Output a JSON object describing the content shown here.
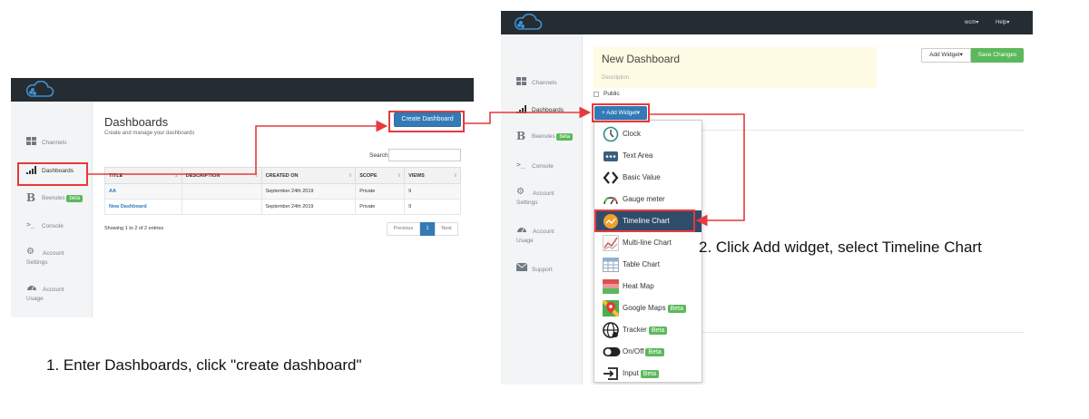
{
  "left": {
    "nav": [
      {
        "label": "Channels",
        "icon": "grid-icon"
      },
      {
        "label": "Dashboards",
        "icon": "bars-chart-icon"
      },
      {
        "label": "Beerules",
        "icon": "beerules-b-icon",
        "badge": "beta"
      },
      {
        "label": "Console",
        "icon": "terminal-icon"
      },
      {
        "label": "Account Settings",
        "icon": "gears-icon"
      },
      {
        "label": "Account Usage",
        "icon": "dashboard-gauge-icon"
      }
    ],
    "title": "Dashboards",
    "subtitle": "Create and manage your dashboards",
    "create_button": "Create Dashboard",
    "search_label": "Search:",
    "table": {
      "headers": [
        "TITLE",
        "DESCRIPTION",
        "CREATED ON",
        "SCOPE",
        "VIEWS"
      ],
      "rows": [
        [
          "AA",
          "",
          "September 24th 2019",
          "Private",
          "9"
        ],
        [
          "New Dashboard",
          "",
          "September 24th 2019",
          "Private",
          "9"
        ]
      ]
    },
    "showing": "Showing 1 to 2 of 2 entries",
    "pager": {
      "prev": "Previous",
      "page": "1",
      "next": "Next"
    }
  },
  "right": {
    "top_menu": {
      "user": "wcm▾",
      "help": "Help▾"
    },
    "nav": [
      {
        "label": "Channels",
        "icon": "grid-icon"
      },
      {
        "label": "Dashboards",
        "icon": "bars-chart-icon"
      },
      {
        "label": "Beerules",
        "icon": "beerules-b-icon",
        "badge": "beta"
      },
      {
        "label": "Console",
        "icon": "terminal-icon"
      },
      {
        "label": "Account Settings",
        "icon": "gears-icon"
      },
      {
        "label": "Account Usage",
        "icon": "dashboard-gauge-icon"
      },
      {
        "label": "Support",
        "icon": "envelope-icon"
      }
    ],
    "dashboard_title": "New Dashboard",
    "description_placeholder": "Description",
    "public_label": "Public",
    "add_widget_button": "+ Add Widget▾",
    "add_widget_top": "Add Widget▾",
    "save_button": "Save Changes",
    "widgets": [
      {
        "label": "Clock",
        "icon": "clock-icon"
      },
      {
        "label": "Text Area",
        "icon": "text-area-icon"
      },
      {
        "label": "Basic Value",
        "icon": "code-brackets-icon"
      },
      {
        "label": "Gauge meter",
        "icon": "gauge-meter-icon"
      },
      {
        "label": "Timeline Chart",
        "icon": "timeline-chart-icon"
      },
      {
        "label": "Multi-line Chart",
        "icon": "multi-line-chart-icon"
      },
      {
        "label": "Table Chart",
        "icon": "table-chart-icon"
      },
      {
        "label": "Heat Map",
        "icon": "heat-map-icon"
      },
      {
        "label": "Google Maps",
        "icon": "google-maps-icon",
        "badge": "Beta"
      },
      {
        "label": "Tracker",
        "icon": "tracker-globe-icon",
        "badge": "Beta"
      },
      {
        "label": "On/Off",
        "icon": "toggle-icon",
        "badge": "Beta"
      },
      {
        "label": "Input",
        "icon": "input-arrow-icon",
        "badge": "Beta"
      }
    ]
  },
  "annotations": {
    "step1": "1. Enter Dashboards, click \"create dashboard\"",
    "step2": "2. Click Add widget, select Timeline Chart"
  },
  "colors": {
    "accent_red": "#e8393b",
    "primary_blue": "#337ab7",
    "success_green": "#5cb85c",
    "topbar": "#252d33"
  }
}
